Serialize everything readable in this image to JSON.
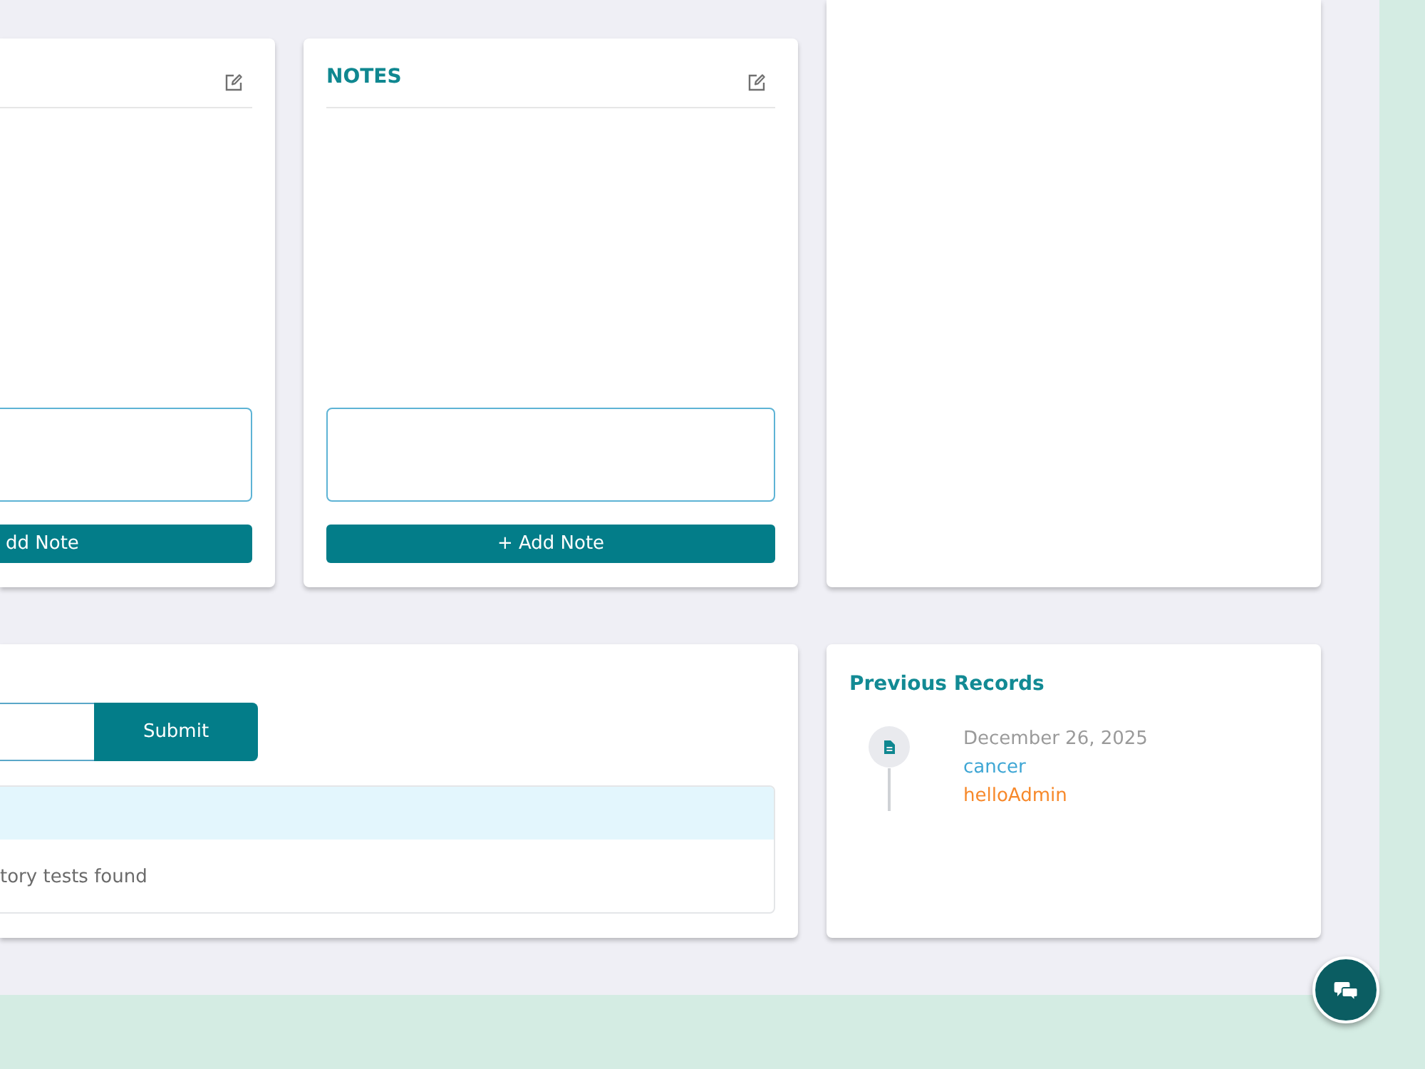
{
  "top_cards": [
    {
      "kind": "notes",
      "add_button": "dd Note"
    },
    {
      "kind": "notes",
      "title": "NOTES",
      "add_button": "+ Add Note"
    },
    {
      "kind": "blank"
    }
  ],
  "tests_card": {
    "submit_button": "Submit",
    "table": {
      "empty_message": "tory tests found"
    }
  },
  "previous_records": {
    "title": "Previous Records",
    "records": [
      {
        "date": "December 26, 2025",
        "label": "cancer",
        "author": "helloAdmin"
      }
    ]
  }
}
